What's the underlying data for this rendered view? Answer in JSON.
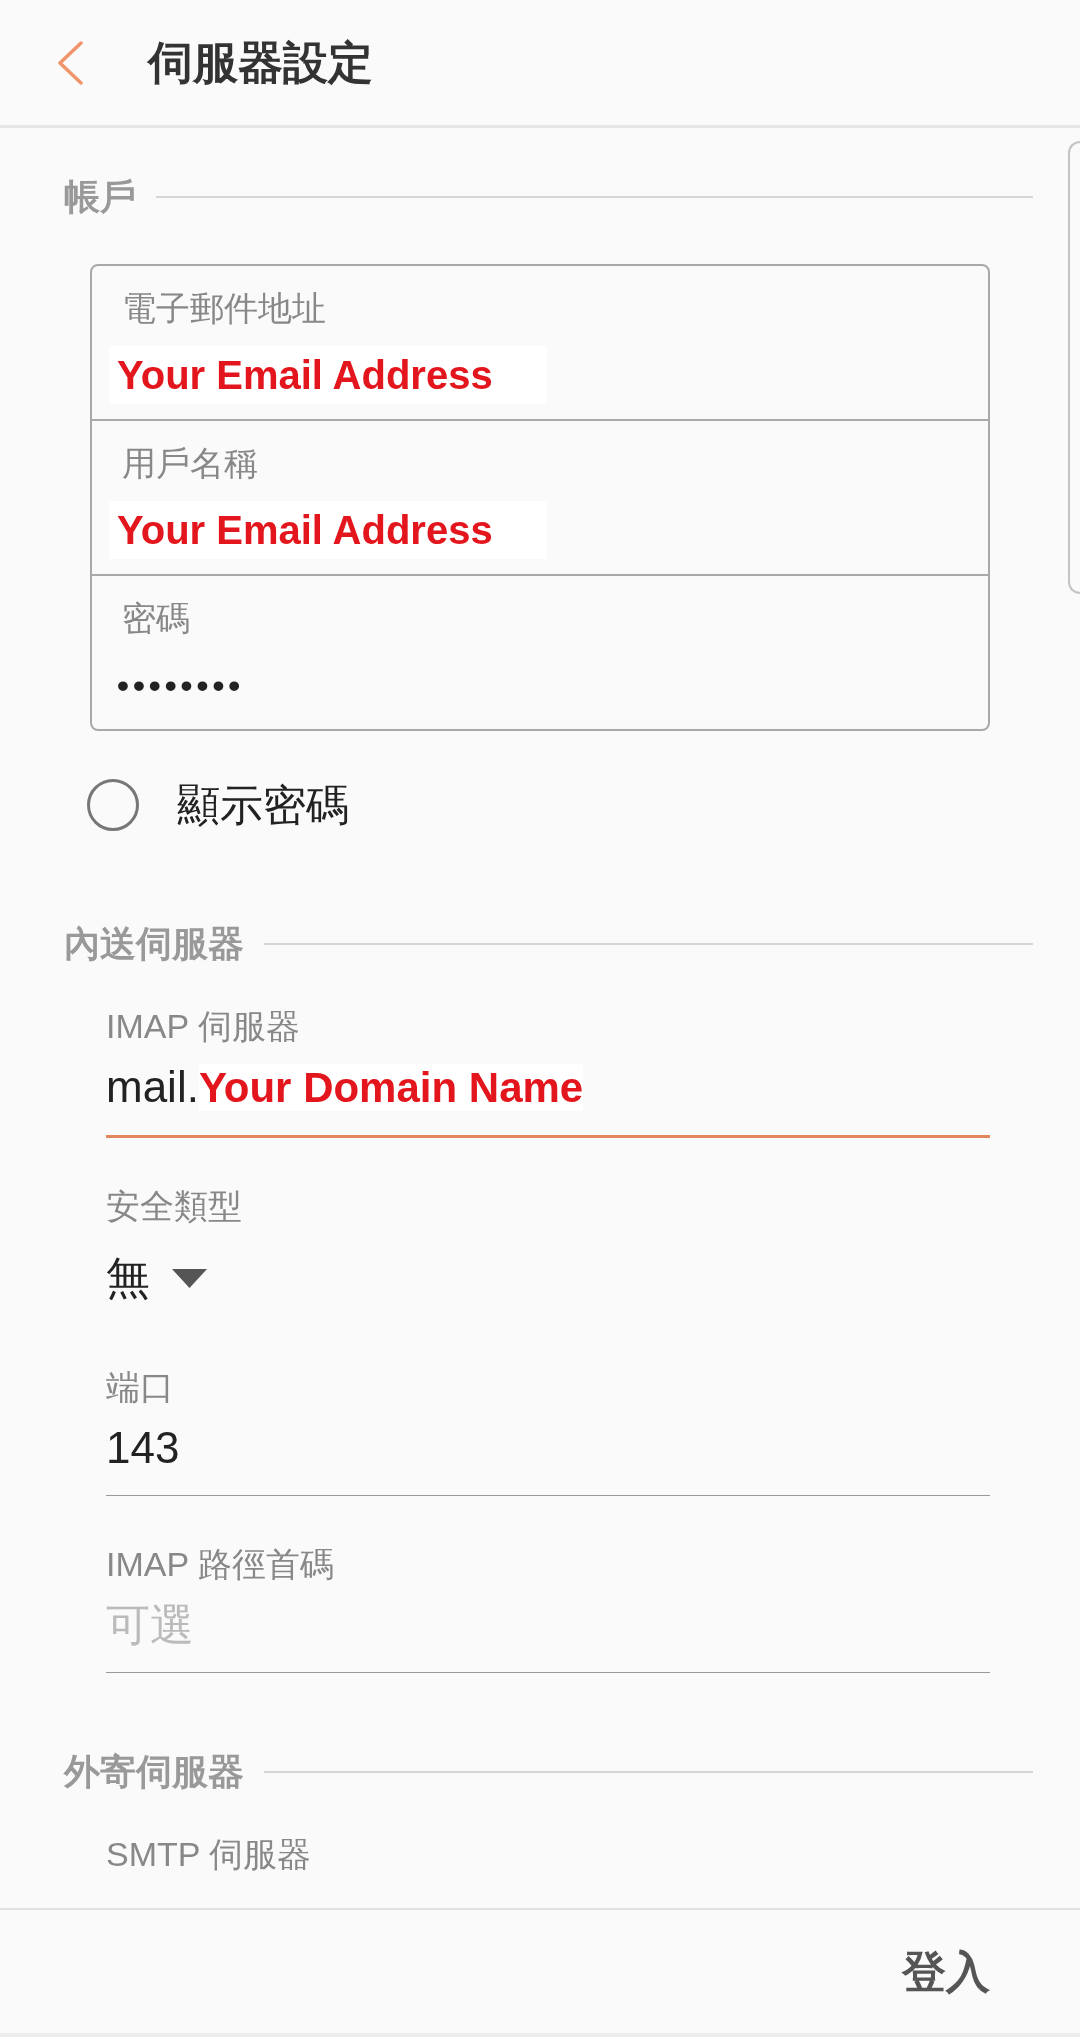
{
  "header": {
    "title": "伺服器設定"
  },
  "account": {
    "title": "帳戶",
    "fields": [
      {
        "label": "電子郵件地址",
        "value": [
          {
            "kind": "annotation",
            "text": "Your Email Address"
          }
        ]
      },
      {
        "label": "用戶名稱",
        "value": [
          {
            "kind": "annotation",
            "text": "Your Email Address"
          }
        ]
      },
      {
        "label": "密碼",
        "value": [
          {
            "kind": "masked",
            "text": "••••••••"
          }
        ]
      }
    ],
    "show_password": {
      "label": "顯示密碼",
      "checked": false
    }
  },
  "incoming": {
    "title": "內送伺服器",
    "fields": [
      {
        "kind": "text",
        "label": "IMAP 伺服器",
        "focused": true,
        "value": [
          {
            "kind": "plain",
            "text": "mail."
          },
          {
            "kind": "annotation",
            "text": "Your Domain Name"
          }
        ]
      },
      {
        "kind": "dropdown",
        "label": "安全類型",
        "value": [
          {
            "kind": "plain",
            "text": "無"
          }
        ]
      },
      {
        "kind": "text",
        "label": "端口",
        "focused": false,
        "value": [
          {
            "kind": "plain",
            "text": "143"
          }
        ]
      },
      {
        "kind": "text",
        "label": "IMAP 路徑首碼",
        "focused": false,
        "placeholder": "可選"
      }
    ]
  },
  "outgoing": {
    "title": "外寄伺服器",
    "fields": [
      {
        "label": "SMTP 伺服器"
      }
    ]
  },
  "footer": {
    "button": "登入"
  }
}
